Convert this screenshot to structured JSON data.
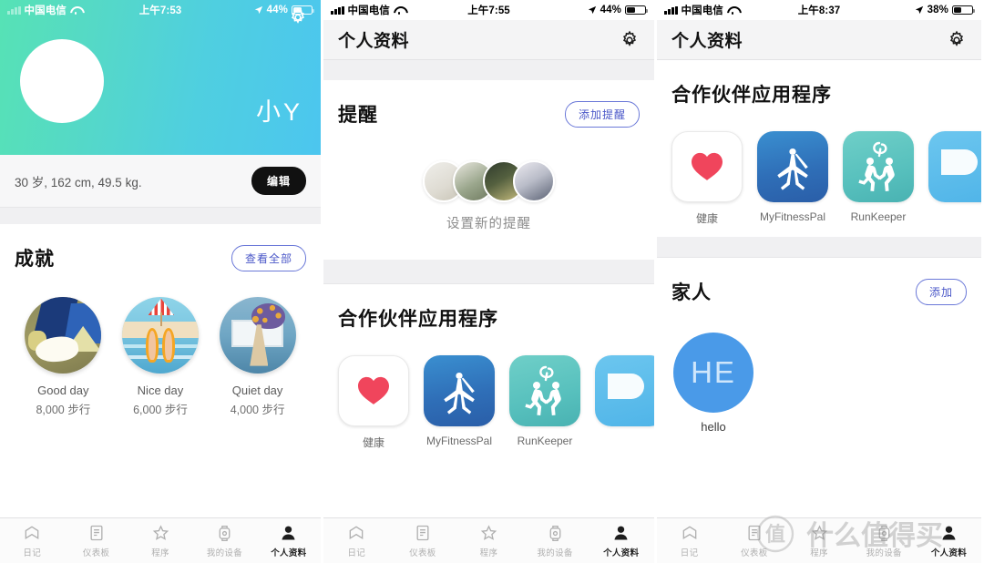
{
  "panel1": {
    "status": {
      "carrier": "中国电信",
      "time": "上午7:53",
      "battery": "44%"
    },
    "hero": {
      "name": "小Y",
      "gear_icon": "gear-icon"
    },
    "bio": {
      "text": "30 岁, 162 cm, 49.5 kg.",
      "edit_label": "编辑"
    },
    "achievements": {
      "title": "成就",
      "view_all_label": "查看全部",
      "items": [
        {
          "label": "Good day",
          "sub": "8,000 步行",
          "icon": "walking-shoe-badge"
        },
        {
          "label": "Nice day",
          "sub": "6,000 步行",
          "icon": "beach-flipflops-badge"
        },
        {
          "label": "Quiet day",
          "sub": "4,000 步行",
          "icon": "quiet-reading-badge"
        }
      ]
    }
  },
  "panel2": {
    "status": {
      "carrier": "中国电信",
      "time": "上午7:55",
      "battery": "44%"
    },
    "nav": {
      "title": "个人资料",
      "gear_icon": "gear-icon"
    },
    "reminders": {
      "title": "提醒",
      "add_label": "添加提醒",
      "empty_label": "设置新的提醒"
    },
    "partner_apps": {
      "title": "合作伙伴应用程序",
      "items": [
        {
          "name": "健康",
          "icon": "apple-health-icon"
        },
        {
          "name": "MyFitnessPal",
          "icon": "myfitnesspal-icon"
        },
        {
          "name": "RunKeeper",
          "icon": "runkeeper-icon"
        },
        {
          "name": "",
          "icon": "partial-blue-app-icon"
        }
      ]
    }
  },
  "panel3": {
    "status": {
      "carrier": "中国电信",
      "time": "上午8:37",
      "battery": "38%"
    },
    "nav": {
      "title": "个人资料",
      "gear_icon": "gear-icon"
    },
    "partner_apps": {
      "title": "合作伙伴应用程序",
      "items": [
        {
          "name": "健康",
          "icon": "apple-health-icon"
        },
        {
          "name": "MyFitnessPal",
          "icon": "myfitnesspal-icon"
        },
        {
          "name": "RunKeeper",
          "icon": "runkeeper-icon"
        },
        {
          "name": "",
          "icon": "partial-blue-app-icon"
        }
      ]
    },
    "family": {
      "title": "家人",
      "add_label": "添加",
      "members": [
        {
          "initials": "HE",
          "name": "hello"
        }
      ]
    },
    "watermark": "什么值得买"
  },
  "tabbar": {
    "items": [
      {
        "label": "日记",
        "icon": "bookmark-icon",
        "active": false
      },
      {
        "label": "仪表板",
        "icon": "document-icon",
        "active": false
      },
      {
        "label": "程序",
        "icon": "star-icon",
        "active": false
      },
      {
        "label": "我的设备",
        "icon": "watch-icon",
        "active": false
      },
      {
        "label": "个人资料",
        "icon": "person-icon",
        "active": true
      }
    ]
  },
  "colors": {
    "hero_gradient_start": "#56e2b5",
    "hero_gradient_end": "#4cc6ef",
    "pill_accent": "#4a57c8",
    "edit_button_bg": "#111111",
    "family_avatar_bg": "#4a9ae8"
  }
}
